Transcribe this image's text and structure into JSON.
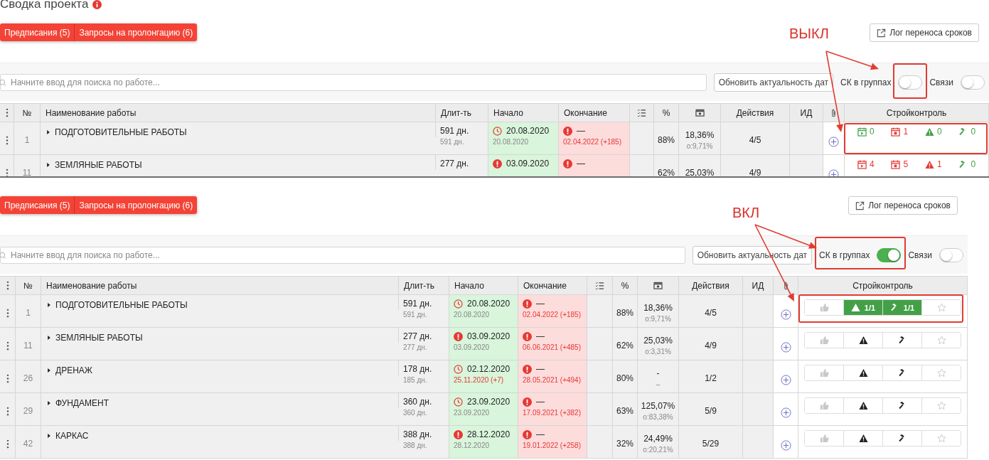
{
  "panels": [
    {
      "annotation": "ВЫКЛ",
      "title": "Сводка проекта",
      "buttons": [
        "Предписания (5)",
        "Запросы на пролонгацию (6)"
      ],
      "log_button": "Лог переноса сроков",
      "search": {
        "placeholder": "Начните ввод для поиска по работе..."
      },
      "refresh_button": "Обновить актуальность дат",
      "toggles": [
        {
          "label": "СК в группах",
          "on": false
        },
        {
          "label": "Связи",
          "on": false
        }
      ],
      "columns": {
        "num": "№",
        "name": "Наименование работы",
        "duration": "Длит-ть",
        "start": "Начало",
        "end": "Окончание",
        "percent": "%",
        "actions": "Действия",
        "id": "ИД",
        "sk": "Стройконтроль"
      },
      "rows": [
        {
          "num": "1",
          "name": "ПОДГОТОВИТЕЛЬНЫЕ РАБОТЫ",
          "duration": {
            "value": "591 дн.",
            "planned": "591 дн."
          },
          "start": {
            "kind": "clock",
            "date": "20.08.2020",
            "planned": "20.08.2020",
            "shifted": false
          },
          "end": {
            "kind": "alert",
            "date": "—",
            "planned": "02.04.2022 (+185)",
            "shifted": true
          },
          "percent": "88%",
          "budget": {
            "value": "18,36%",
            "sub": "о:9,71%"
          },
          "actions": "4/5",
          "sk": {
            "kind": "counts",
            "items": [
              {
                "kind": "calendar-start",
                "count": "0",
                "alert": false
              },
              {
                "kind": "calendar-stop",
                "count": "1",
                "alert": true
              },
              {
                "kind": "warning",
                "count": "0",
                "alert": false
              },
              {
                "kind": "hammer",
                "count": "0",
                "alert": false
              }
            ]
          }
        },
        {
          "num": "11",
          "name": "ЗЕМЛЯНЫЕ РАБОТЫ",
          "duration": {
            "value": "277 дн."
          },
          "start": {
            "kind": "alert",
            "date": "03.09.2020"
          },
          "end": {
            "kind": "alert",
            "date": "—"
          },
          "percent": "62%",
          "budget": {
            "value": "25,03%"
          },
          "actions": "4/9",
          "sk": {
            "kind": "counts",
            "items": [
              {
                "kind": "calendar-start",
                "count": "4",
                "alert": true
              },
              {
                "kind": "calendar-stop",
                "count": "5",
                "alert": true
              },
              {
                "kind": "warning",
                "count": "1",
                "alert": true
              },
              {
                "kind": "hammer",
                "count": "0",
                "alert": false
              }
            ]
          }
        }
      ]
    },
    {
      "annotation": "ВКЛ",
      "buttons": [
        "Предписания (5)",
        "Запросы на пролонгацию (6)"
      ],
      "log_button": "Лог переноса сроков",
      "search": {
        "placeholder": "Начните ввод для поиска по работе..."
      },
      "refresh_button": "Обновить актуальность дат",
      "toggles": [
        {
          "label": "СК в группах",
          "on": true
        },
        {
          "label": "Связи",
          "on": false
        }
      ],
      "columns": {
        "num": "№",
        "name": "Наименование работы",
        "duration": "Длит-ть",
        "start": "Начало",
        "end": "Окончание",
        "percent": "%",
        "actions": "Действия",
        "id": "ИД",
        "sk": "Стройконтроль"
      },
      "rows": [
        {
          "num": "1",
          "name": "ПОДГОТОВИТЕЛЬНЫЕ РАБОТЫ",
          "duration": {
            "value": "591 дн.",
            "planned": "591 дн."
          },
          "start": {
            "kind": "clock",
            "date": "20.08.2020",
            "planned": "20.08.2020",
            "shifted": false
          },
          "end": {
            "kind": "alert",
            "date": "—",
            "planned": "02.04.2022 (+185)",
            "shifted": true
          },
          "percent": "88%",
          "budget": {
            "value": "18,36%",
            "sub": "о:9,71%"
          },
          "actions": "4/5",
          "sk": {
            "kind": "buttons",
            "items": [
              {
                "kind": "like",
                "active": false
              },
              {
                "kind": "warning",
                "active": true,
                "count": "1/1"
              },
              {
                "kind": "hammer",
                "active": true,
                "count": "1/1"
              },
              {
                "kind": "star",
                "active": false
              }
            ]
          }
        },
        {
          "num": "11",
          "name": "ЗЕМЛЯНЫЕ РАБОТЫ",
          "duration": {
            "value": "277 дн.",
            "planned": "277 дн."
          },
          "start": {
            "kind": "alert",
            "date": "03.09.2020",
            "planned": "03.09.2020",
            "shifted": false
          },
          "end": {
            "kind": "alert",
            "date": "—",
            "planned": "06.06.2021 (+485)",
            "shifted": true
          },
          "percent": "62%",
          "budget": {
            "value": "25,03%",
            "sub": "о:3,31%"
          },
          "actions": "4/9",
          "sk": {
            "kind": "buttons",
            "items": [
              {
                "kind": "like",
                "active": false
              },
              {
                "kind": "warning",
                "active": false
              },
              {
                "kind": "hammer",
                "active": false
              },
              {
                "kind": "star",
                "active": false
              }
            ]
          }
        },
        {
          "num": "26",
          "name": "ДРЕНАЖ",
          "duration": {
            "value": "178 дн.",
            "planned": "185 дн."
          },
          "start": {
            "kind": "clock",
            "date": "02.12.2020",
            "planned": "25.11.2020 (+7)",
            "shifted": true
          },
          "end": {
            "kind": "alert",
            "date": "—",
            "planned": "28.05.2021 (+494)",
            "shifted": true
          },
          "percent": "80%",
          "budget": {
            "value": "-",
            "sub": "–"
          },
          "actions": "1/2",
          "sk": {
            "kind": "buttons",
            "items": [
              {
                "kind": "like",
                "active": false
              },
              {
                "kind": "warning",
                "active": false
              },
              {
                "kind": "hammer",
                "active": false
              },
              {
                "kind": "star",
                "active": false
              }
            ]
          }
        },
        {
          "num": "29",
          "name": "ФУНДАМЕНТ",
          "duration": {
            "value": "360 дн.",
            "planned": "360 дн."
          },
          "start": {
            "kind": "clock",
            "date": "23.09.2020",
            "planned": "23.09.2020",
            "shifted": false
          },
          "end": {
            "kind": "alert",
            "date": "—",
            "planned": "17.09.2021 (+382)",
            "shifted": true
          },
          "percent": "63%",
          "budget": {
            "value": "125,07%",
            "sub": "о:83,38%"
          },
          "actions": "5/9",
          "sk": {
            "kind": "buttons",
            "items": [
              {
                "kind": "like",
                "active": false
              },
              {
                "kind": "warning",
                "active": false
              },
              {
                "kind": "hammer",
                "active": false
              },
              {
                "kind": "star",
                "active": false
              }
            ]
          }
        },
        {
          "num": "42",
          "name": "КАРКАС",
          "duration": {
            "value": "388 дн.",
            "planned": "388 дн."
          },
          "start": {
            "kind": "alert",
            "date": "28.12.2020",
            "planned": "28.12.2020",
            "shifted": false
          },
          "end": {
            "kind": "alert",
            "date": "—",
            "planned": "19.01.2022 (+258)",
            "shifted": true
          },
          "percent": "32%",
          "budget": {
            "value": "24,49%",
            "sub": "о:20,21%"
          },
          "actions": "5/29",
          "sk": {
            "kind": "buttons",
            "items": [
              {
                "kind": "like",
                "active": false
              },
              {
                "kind": "warning",
                "active": false
              },
              {
                "kind": "hammer",
                "active": false
              },
              {
                "kind": "star",
                "active": false
              }
            ]
          }
        }
      ]
    }
  ]
}
